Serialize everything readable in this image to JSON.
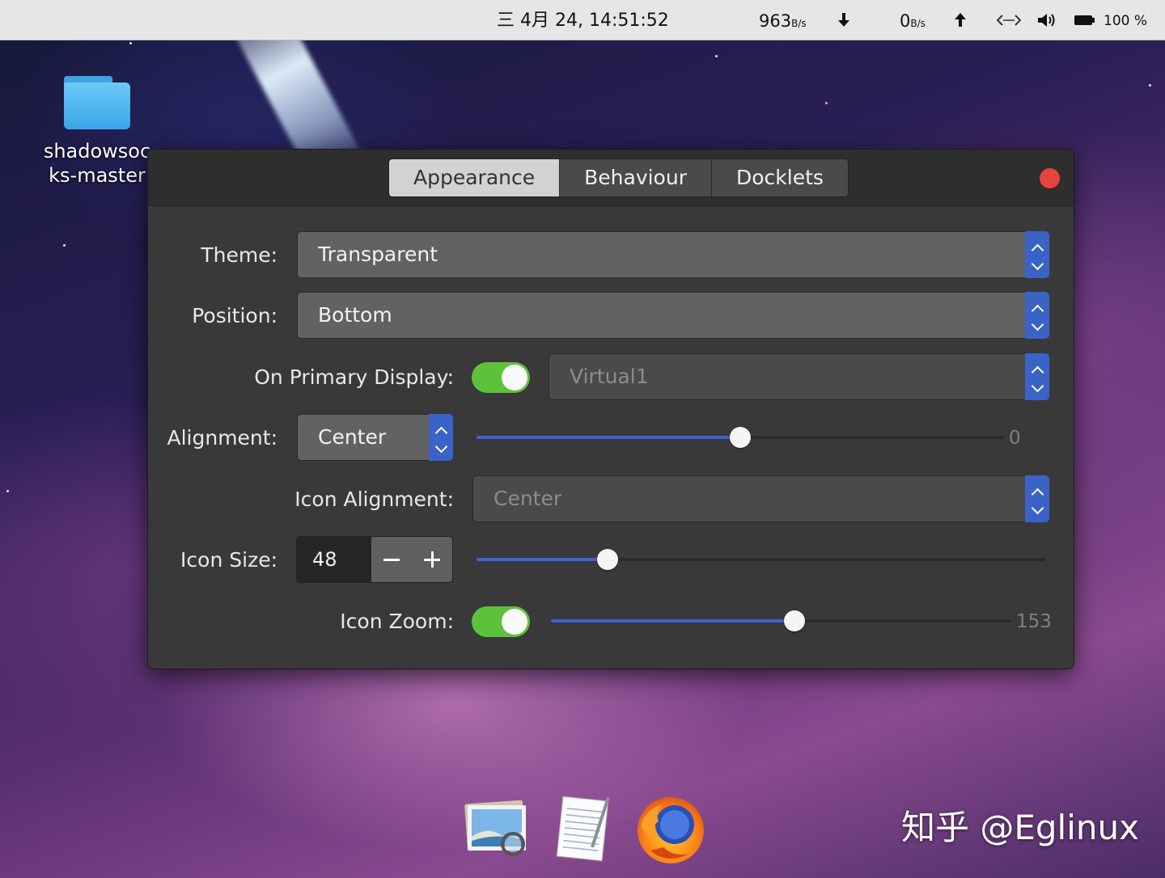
{
  "topbar": {
    "date_time": "三 4月 24, 14:51:52",
    "download_value": "963",
    "download_unit": "B/s",
    "upload_value": "0",
    "upload_unit": "B/s",
    "battery_percent": "100 %",
    "icons": [
      "download-arrow-icon",
      "upload-arrow-icon",
      "network-icon",
      "volume-icon",
      "battery-icon"
    ]
  },
  "desktop": {
    "folder_label": "shadowsoc\nks-master"
  },
  "window": {
    "tabs": [
      {
        "label": "Appearance",
        "active": true
      },
      {
        "label": "Behaviour",
        "active": false
      },
      {
        "label": "Docklets",
        "active": false
      }
    ],
    "close_color": "#e8433f",
    "theme": {
      "label": "Theme:",
      "value": "Transparent"
    },
    "position": {
      "label": "Position:",
      "value": "Bottom"
    },
    "primary_display": {
      "label": "On Primary Display:",
      "enabled": true,
      "value": "Virtual1"
    },
    "alignment": {
      "label": "Alignment:",
      "value": "Center",
      "offset_value": "0",
      "slider_fraction": 0.5
    },
    "icon_alignment": {
      "label": "Icon Alignment:",
      "value": "Center"
    },
    "icon_size": {
      "label": "Icon Size:",
      "value": "48",
      "slider_fraction": 0.23
    },
    "icon_zoom": {
      "label": "Icon Zoom:",
      "enabled": true,
      "value": "153",
      "slider_fraction": 0.53
    }
  },
  "colors": {
    "accent": "#3b62d8",
    "toggle_on": "#5dc23b",
    "window_bg": "#393939"
  },
  "dock": {
    "items": [
      "image-viewer-icon",
      "text-editor-icon",
      "firefox-icon"
    ]
  },
  "watermark": "知乎 @Eglinux"
}
